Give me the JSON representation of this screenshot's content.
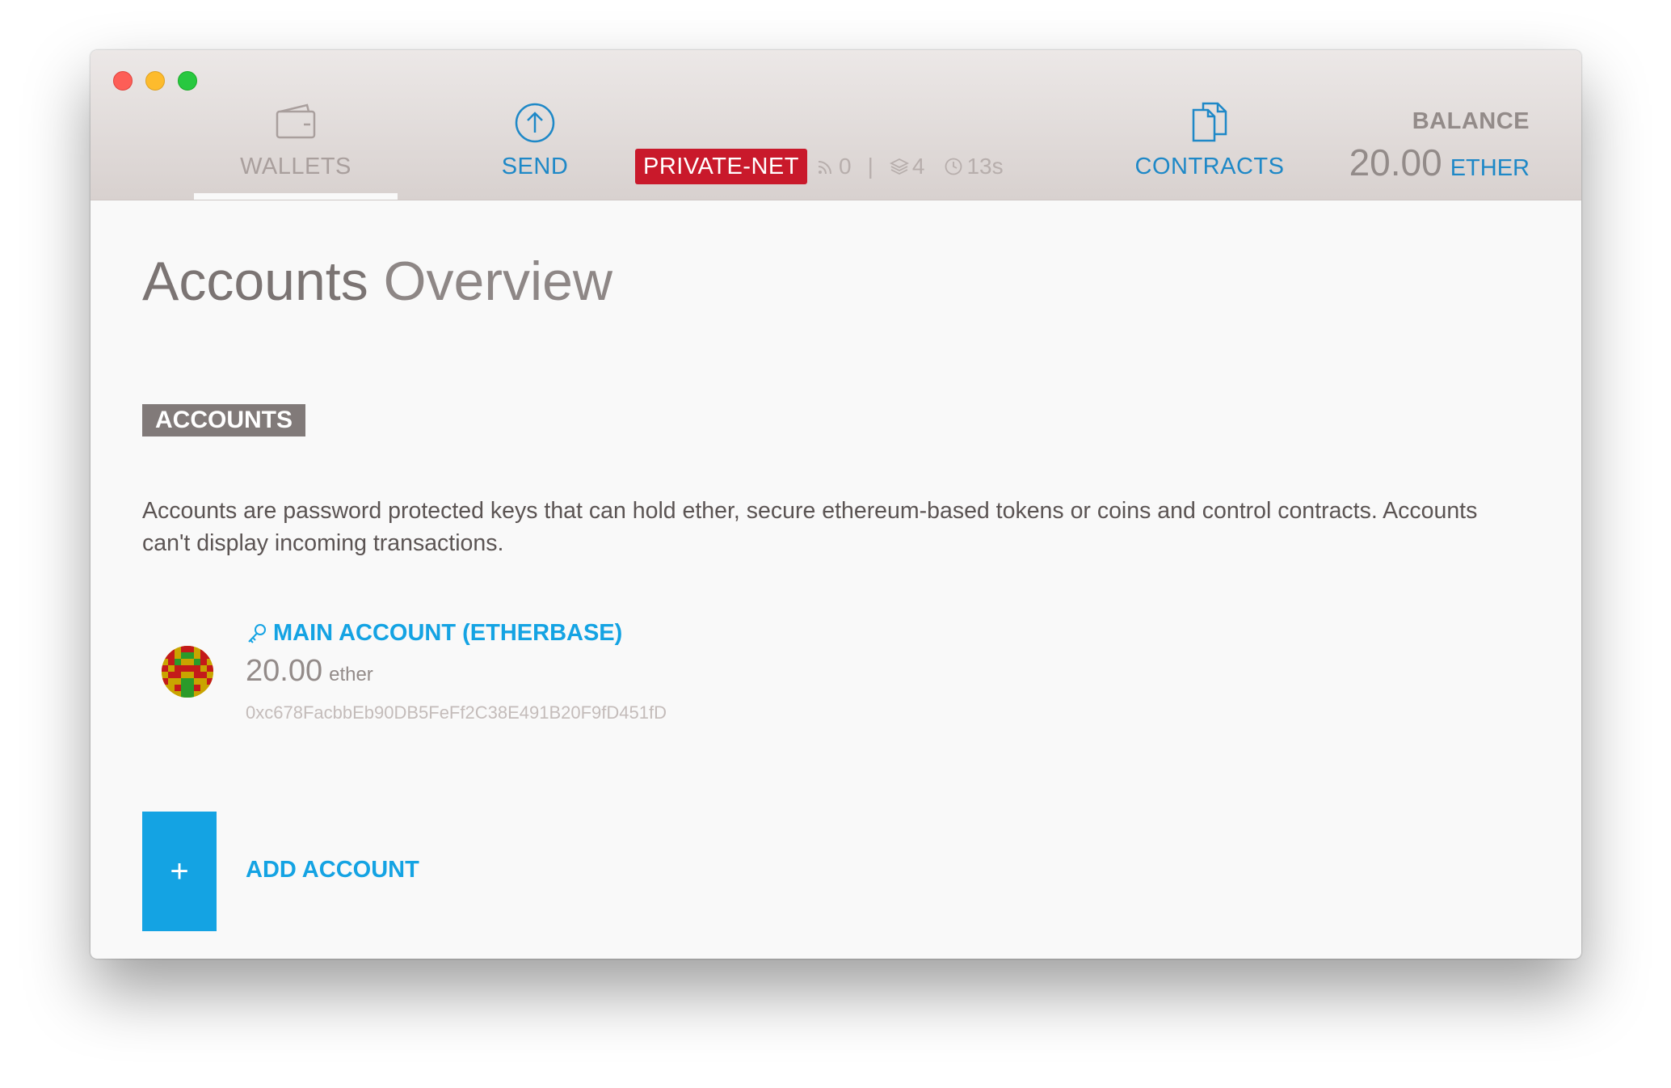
{
  "header": {
    "nav": {
      "wallets_label": "WALLETS",
      "send_label": "SEND",
      "contracts_label": "CONTRACTS"
    },
    "network": {
      "name": "PRIVATE-NET",
      "peers": "0",
      "blocks": "4",
      "last_block": "13s"
    },
    "balance": {
      "label": "BALANCE",
      "amount": "20.00",
      "unit": "ETHER"
    }
  },
  "main": {
    "title_strong": "Accounts",
    "title_light": "Overview",
    "section_tag": "ACCOUNTS",
    "description": "Accounts are password protected keys that can hold ether, secure ethereum-based tokens or coins and control contracts. Accounts can't display incoming transactions.",
    "accounts": [
      {
        "name": "MAIN ACCOUNT (ETHERBASE)",
        "balance": "20.00",
        "unit": "ether",
        "address": "0xc678FacbbEb90DB5FeFf2C38E491B20F9fD451fD"
      }
    ],
    "add_account": {
      "icon": "+",
      "label": "ADD ACCOUNT"
    }
  },
  "colors": {
    "accent_blue": "#1e88c7",
    "link_blue": "#14a3e3",
    "network_red": "#c9192b"
  }
}
